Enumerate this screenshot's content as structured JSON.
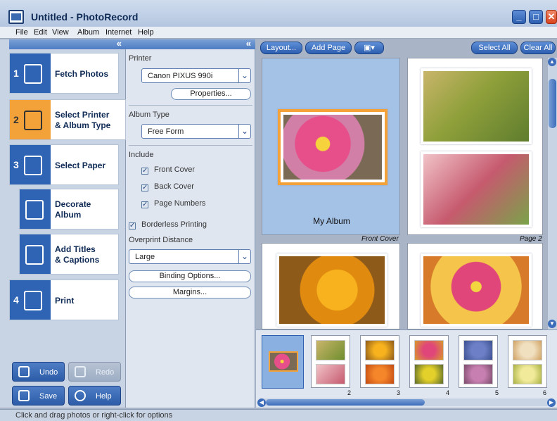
{
  "window": {
    "title": "Untitled - PhotoRecord",
    "buttons": [
      "minimize",
      "maximize",
      "close"
    ]
  },
  "menu": [
    "File",
    "Edit",
    "View",
    "Album",
    "Internet",
    "Help"
  ],
  "steps": [
    {
      "num": "1",
      "label": "Fetch Photos",
      "icon": "fetch-photos-icon"
    },
    {
      "num": "2",
      "label": "Select Printer",
      "label2": "& Album Type",
      "icon": "printer-icon"
    },
    {
      "num": "3",
      "label": "Select Paper",
      "icon": "paper-icon"
    },
    {
      "num": "",
      "label": "Decorate",
      "label2": "Album",
      "icon": "decorate-icon"
    },
    {
      "num": "",
      "label": "Add Titles",
      "label2": "& Captions",
      "icon": "titles-icon"
    },
    {
      "num": "4",
      "label": "Print",
      "icon": "print-icon"
    }
  ],
  "bottom_buttons": {
    "undo": "Undo",
    "redo": "Redo",
    "save": "Save",
    "help": "Help"
  },
  "settings": {
    "printer_label": "Printer",
    "printer_value": "Canon PIXUS 990i",
    "properties": "Properties...",
    "album_type_label": "Album Type",
    "album_type_value": "Free Form",
    "include_label": "Include",
    "include": [
      {
        "label": "Front Cover",
        "checked": true
      },
      {
        "label": "Back Cover",
        "checked": true
      },
      {
        "label": "Page Numbers",
        "checked": true
      }
    ],
    "borderless": {
      "label": "Borderless Printing",
      "checked": true
    },
    "overprint_label": "Overprint Distance",
    "overprint_value": "Large",
    "binding_options": "Binding Options...",
    "margins": "Margins..."
  },
  "toolbar": {
    "layout": "Layout...",
    "add_page": "Add Page",
    "select_all": "Select All",
    "clear_all": "Clear All"
  },
  "pages": {
    "front_title": "My Album",
    "front_caption": "Front Cover",
    "page2_caption": "Page 2"
  },
  "thumbnails": {
    "numbers": [
      "2",
      "3",
      "4",
      "5",
      "6"
    ]
  },
  "status": "Click and drag photos or right-click for options",
  "colors": {
    "accent": "#2f64b5",
    "active_step": "#f3a23a",
    "front_cover": "#a4c1e6"
  }
}
